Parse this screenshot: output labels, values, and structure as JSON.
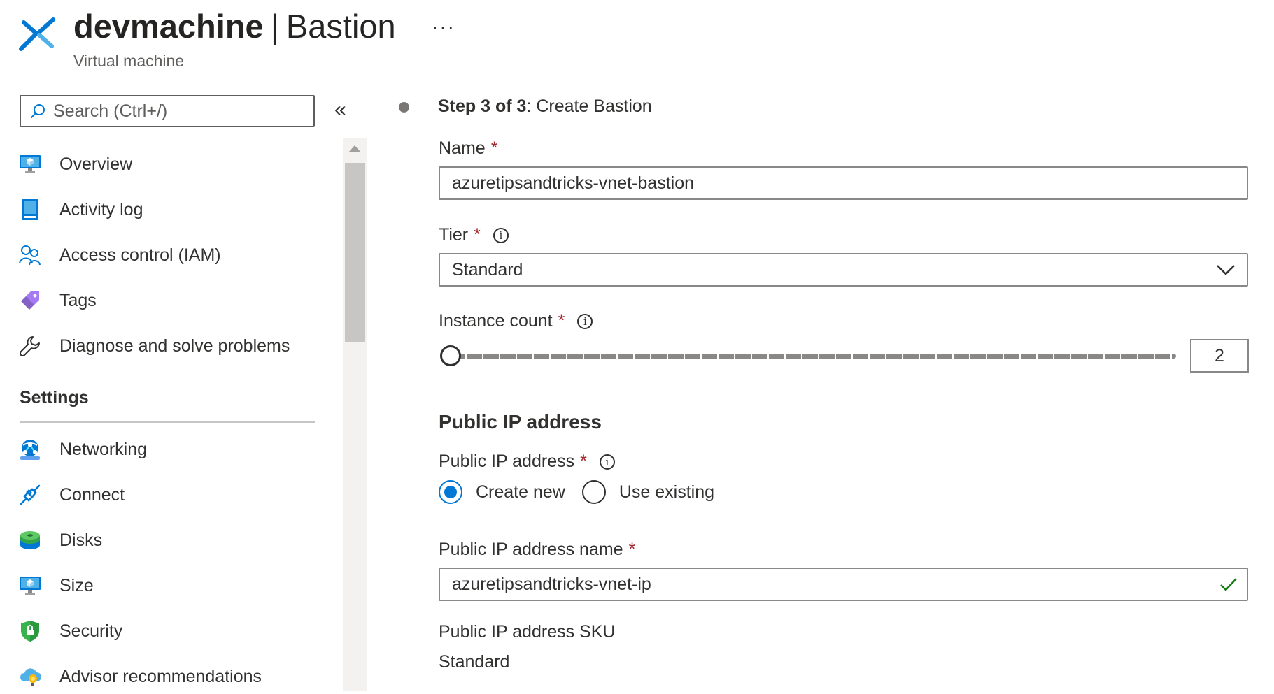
{
  "header": {
    "resource_name": "devmachine",
    "separator": "|",
    "blade_title": "Bastion",
    "resource_type": "Virtual machine",
    "more_label": "···"
  },
  "sidebar": {
    "search_placeholder": "Search (Ctrl+/)",
    "collapse_label": "«",
    "items": [
      {
        "label": "Overview",
        "icon": "monitor-icon"
      },
      {
        "label": "Activity log",
        "icon": "activity-log-icon"
      },
      {
        "label": "Access control (IAM)",
        "icon": "people-icon"
      },
      {
        "label": "Tags",
        "icon": "tag-icon"
      },
      {
        "label": "Diagnose and solve problems",
        "icon": "wrench-icon"
      }
    ],
    "settings_heading": "Settings",
    "settings_items": [
      {
        "label": "Networking",
        "icon": "globe-network-icon"
      },
      {
        "label": "Connect",
        "icon": "plug-icon"
      },
      {
        "label": "Disks",
        "icon": "disks-icon"
      },
      {
        "label": "Size",
        "icon": "monitor-icon"
      },
      {
        "label": "Security",
        "icon": "shield-icon"
      },
      {
        "label": "Advisor recommendations",
        "icon": "advisor-cloud-icon"
      }
    ]
  },
  "main": {
    "step_bold": "Step 3 of 3",
    "step_rest": ": Create Bastion",
    "name_label": "Name",
    "name_value": "azuretipsandtricks-vnet-bastion",
    "tier_label": "Tier",
    "tier_value": "Standard",
    "instance_label": "Instance count",
    "instance_value": "2",
    "required_mark": "*",
    "info_mark": "i",
    "public_ip_heading": "Public IP address",
    "public_ip_label": "Public IP address",
    "radio_create": "Create new",
    "radio_existing": "Use existing",
    "radio_selected": "Create new",
    "ip_name_label": "Public IP address name",
    "ip_name_value": "azuretipsandtricks-vnet-ip",
    "sku_label": "Public IP address SKU",
    "sku_value": "Standard"
  },
  "colors": {
    "accent": "#0078d4",
    "required": "#a4262c",
    "valid": "#107c10"
  }
}
